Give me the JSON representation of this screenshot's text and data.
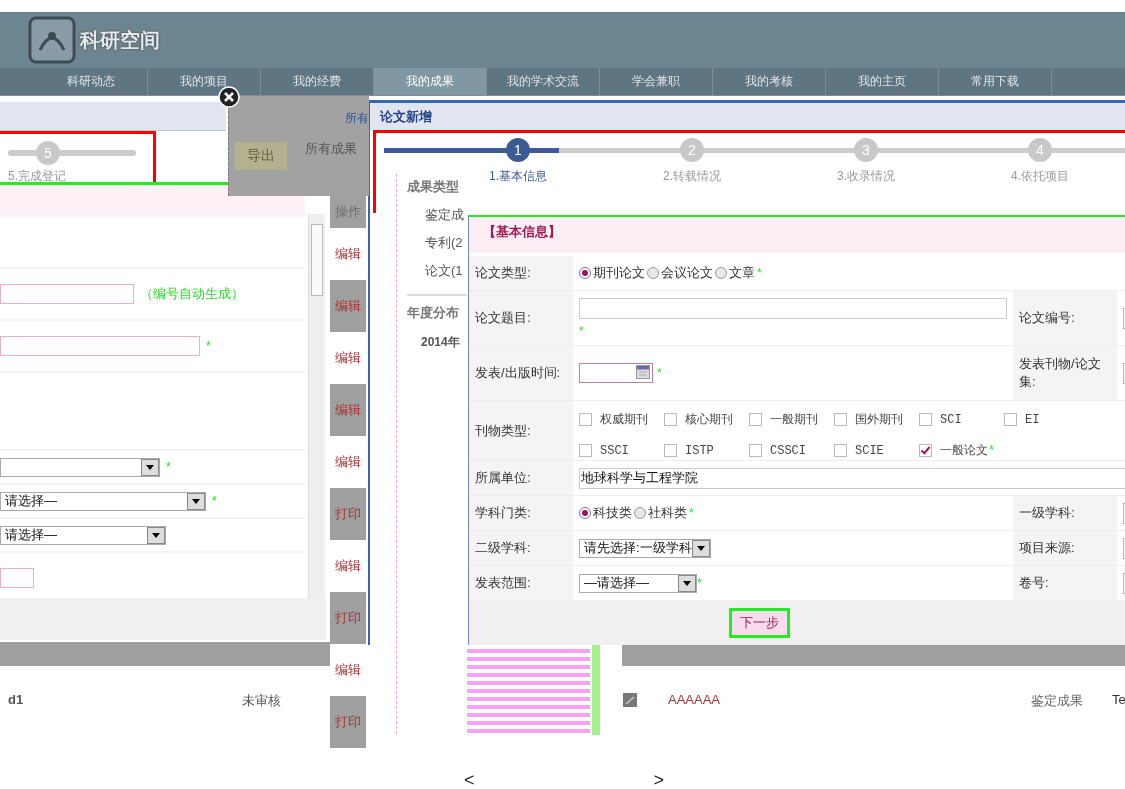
{
  "header": {
    "logo_text": "科研空间"
  },
  "nav": [
    {
      "label": "科研动态",
      "selected": false
    },
    {
      "label": "我的项目",
      "selected": false
    },
    {
      "label": "我的经费",
      "selected": false
    },
    {
      "label": "我的成果",
      "selected": true
    },
    {
      "label": "我的学术交流",
      "selected": false
    },
    {
      "label": "学会兼职",
      "selected": false
    },
    {
      "label": "我的考核",
      "selected": false
    },
    {
      "label": "我的主页",
      "selected": false
    },
    {
      "label": "常用下载",
      "selected": false
    }
  ],
  "page": {
    "toolbar": {
      "link": "所有",
      "export_button": "导出",
      "tab": "所有成果"
    },
    "ops_header": "操作",
    "ops": [
      "编辑",
      "编辑",
      "编辑",
      "编辑",
      "编辑",
      "打印",
      "编辑",
      "打印",
      "编辑",
      "打印"
    ],
    "sidebar": {
      "title": "成果类型",
      "items": [
        "鉴定成",
        "专利(2",
        "论文(1"
      ],
      "year_title": "年度分布",
      "years": [
        "2014年"
      ]
    },
    "left_row": [
      "d1",
      "未审核"
    ],
    "right_row": [
      "AAAAAA",
      "鉴定成果",
      "Te"
    ]
  },
  "pagination": {
    "prev": "<",
    "next": ">"
  },
  "left_dialog": {
    "step": {
      "number": "5",
      "label": "5.完成登记"
    },
    "rows": [
      {
        "kind": "blank"
      },
      {
        "kind": "input",
        "note": "（编号自动生成）"
      },
      {
        "kind": "input",
        "req": "*"
      },
      {
        "kind": "blank"
      },
      {
        "kind": "select",
        "req": "*"
      },
      {
        "kind": "select",
        "value": "请选择—",
        "req": "*"
      },
      {
        "kind": "select",
        "value": "请选择—"
      },
      {
        "kind": "input"
      }
    ]
  },
  "paper_dialog": {
    "title": "论文新增",
    "steps": [
      {
        "number": "1",
        "label": "1.基本信息",
        "selected": true
      },
      {
        "number": "2",
        "label": "2.转载情况",
        "selected": false
      },
      {
        "number": "3",
        "label": "3.收录情况",
        "selected": false
      },
      {
        "number": "4",
        "label": "4.依托项目",
        "selected": false
      }
    ],
    "section": "【基本信息】",
    "rows": [
      {
        "kind": "radios",
        "label": "论文类型:",
        "req": "*",
        "options": [
          {
            "label": "期刊论文",
            "selected": true
          },
          {
            "label": "会议论文",
            "selected": false
          },
          {
            "label": "文章",
            "selected": false
          }
        ]
      },
      {
        "kind": "input",
        "label": "论文题目:",
        "req": "*",
        "side_label": "论文编号:"
      },
      {
        "kind": "date",
        "label": "发表/出版时间:",
        "req": "*",
        "side_label": "发表刊物/论文集:"
      },
      {
        "kind": "checks",
        "label": "刊物类型:",
        "req": "*",
        "options": [
          {
            "label": "权威期刊",
            "checked": false
          },
          {
            "label": "核心期刊",
            "checked": false
          },
          {
            "label": "一般期刊",
            "checked": false
          },
          {
            "label": "国外期刊",
            "checked": false
          },
          {
            "label": "SCI",
            "checked": false
          },
          {
            "label": "EI",
            "checked": false
          },
          {
            "label": "SSCI",
            "checked": false
          },
          {
            "label": "ISTP",
            "checked": false
          },
          {
            "label": "CSSCI",
            "checked": false
          },
          {
            "label": "SCIE",
            "checked": false
          },
          {
            "label": "一般论文",
            "checked": true
          }
        ]
      },
      {
        "kind": "input",
        "label": "所属单位:",
        "value": "地球科学与工程学院"
      },
      {
        "kind": "radios",
        "label": "学科门类:",
        "req": "*",
        "side_label": "一级学科:",
        "options": [
          {
            "label": "科技类",
            "selected": true
          },
          {
            "label": "社科类",
            "selected": false
          }
        ]
      },
      {
        "kind": "select",
        "label": "二级学科:",
        "value": "请先选择:一级学科",
        "side_label": "项目来源:"
      },
      {
        "kind": "select",
        "label": "发表范围:",
        "value": "—请选择—",
        "req": "*",
        "side_label": "卷号:"
      }
    ],
    "next_button": "下一步"
  }
}
